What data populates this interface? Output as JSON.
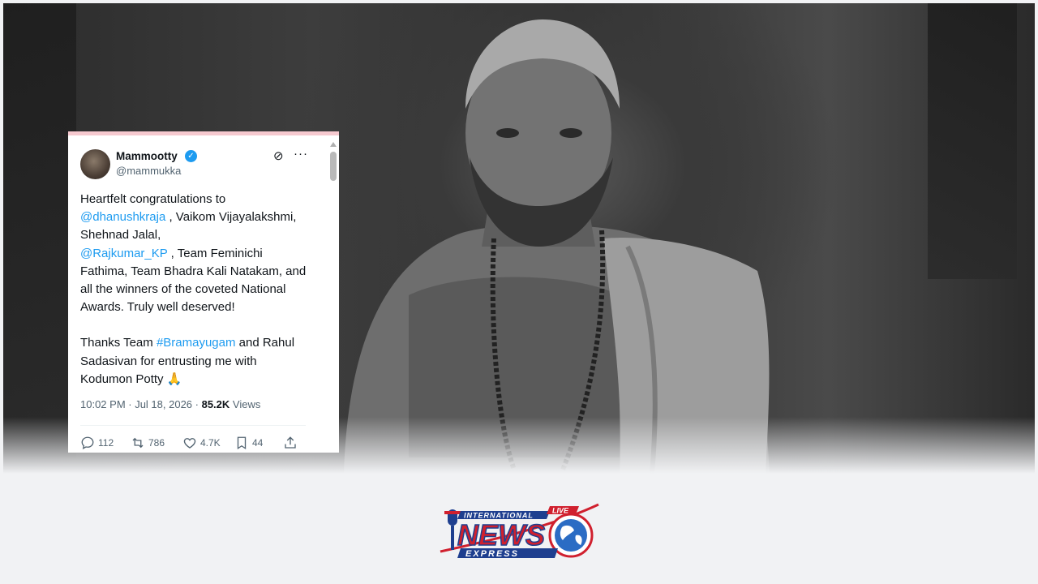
{
  "tweet": {
    "name": "Mammootty",
    "handle": "@mammukka",
    "body": {
      "line1": "Heartfelt congratulations to",
      "mention1": "@dhanushkraja",
      "text2": " , Vaikom Vijayalakshmi, Shehnad Jalal,",
      "mention2": "@Rajkumar_KP",
      "text3": " , Team Feminichi Fathima, Team Bhadra Kali Natakam, and all the winners of the coveted National Awards. Truly well deserved!",
      "para2_start": "Thanks Team ",
      "hashtag": "#Bramayugam",
      "para2_end": " and Rahul Sadasivan for entrusting me with Kodumon Potty ",
      "emoji": "🙏"
    },
    "time": "10:02 PM · Jul 18, 2026 · ",
    "views_count": "85.2K",
    "views_label": " Views",
    "actions": {
      "replies": "112",
      "reposts": "786",
      "likes": "4.7K",
      "bookmarks": "44"
    }
  },
  "logo": {
    "top": "INTERNATIONAL",
    "live": "LIVE",
    "main": "NEWS",
    "bottom": "EXPRESS"
  },
  "icons": [
    "verified-badge-icon",
    "grok-icon",
    "more-options-icon",
    "reply-icon",
    "repost-icon",
    "like-icon",
    "bookmark-icon",
    "share-icon",
    "microphone-icon",
    "globe-icon"
  ],
  "colors": {
    "link": "#1d9bf0",
    "logo_red": "#d0202e",
    "logo_blue": "#1e3f8f",
    "page_bg": "#f1f2f4"
  }
}
